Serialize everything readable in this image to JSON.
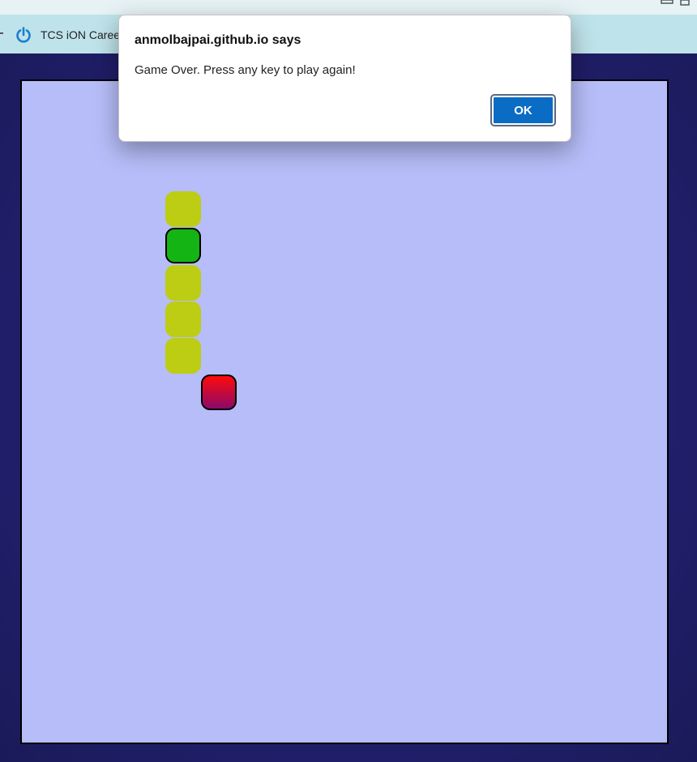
{
  "browser": {
    "bookmark_label": "TCS iON Caree",
    "bookmark_icon": "power-icon"
  },
  "dialog": {
    "title": "anmolbajpai.github.io says",
    "message": "Game Over. Press any key to play again!",
    "ok_label": "OK",
    "ok_color": "#0a6cc4"
  },
  "game": {
    "board_color": "#b6bdf8",
    "snake_head_color": "#14b414",
    "snake_body_color": "#bdcd14",
    "food_color": "#ff0a0a",
    "snake_segments": 5
  }
}
